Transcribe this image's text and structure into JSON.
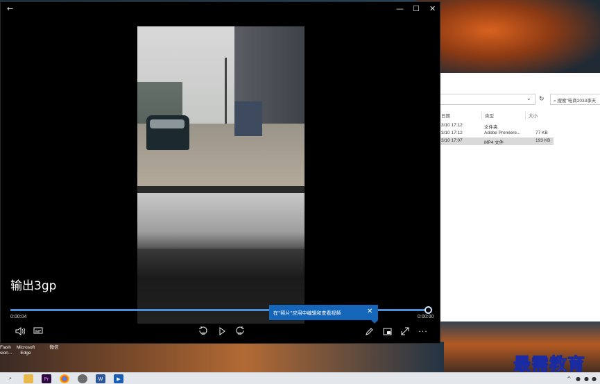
{
  "player": {
    "video_title": "输出3gp",
    "elapsed_time": "0:00:04",
    "remaining_time": "0:00:00",
    "progress_fraction": 0.999,
    "tooltip_text": "在\"照片\"应用中编辑和查看视频"
  },
  "explorer": {
    "search_placeholder": "搜索\"电商2033李天",
    "columns": [
      "日期",
      "类型",
      "大小"
    ],
    "rows": [
      {
        "date": "3/10 17:12",
        "type": "文件夹",
        "size": ""
      },
      {
        "date": "3/10 17:12",
        "type": "Adobe Premiere...",
        "size": "77 KB"
      },
      {
        "date": "3/10 17:07",
        "type": "MP4 文件",
        "size": "193 KB"
      }
    ]
  },
  "desktop_icons": [
    {
      "label": "Flash\nsion..."
    },
    {
      "label": "Microsoft\nEdge"
    },
    {
      "label": "微信"
    }
  ],
  "watermark": "最需教育",
  "colors": {
    "accent": "#4a8fd8",
    "tooltip": "#1565b8",
    "player_bg": "#000000"
  }
}
